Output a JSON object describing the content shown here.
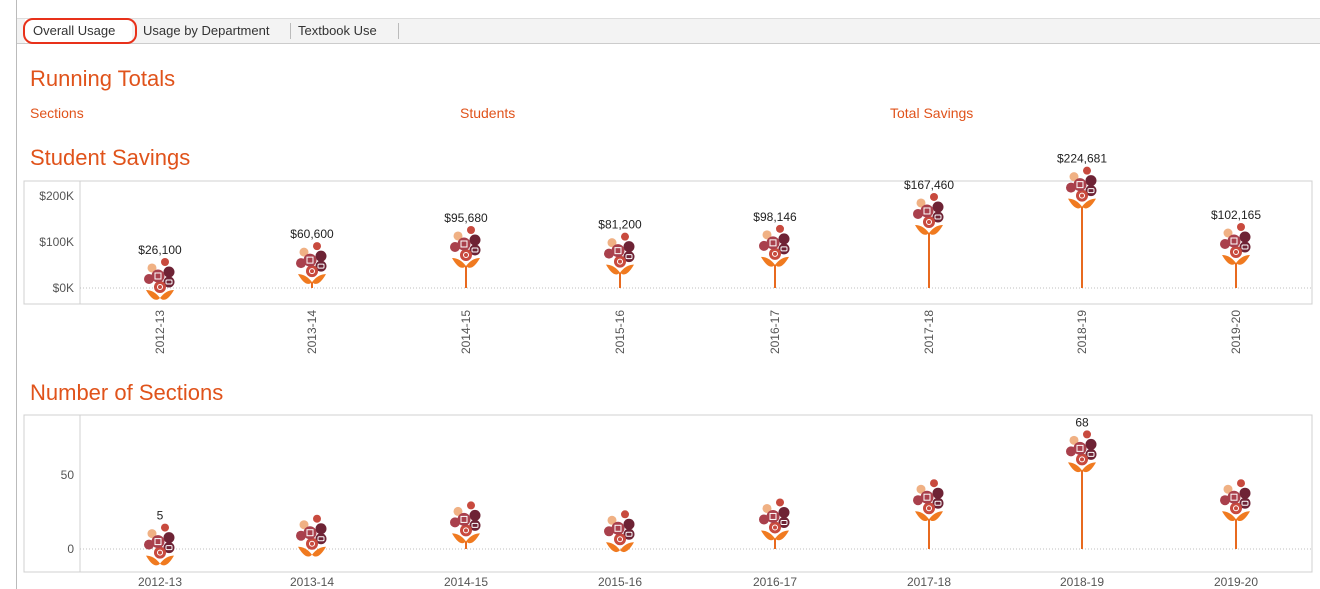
{
  "tabs": [
    {
      "label": "Overall Usage",
      "active": true
    },
    {
      "label": "Usage by Department",
      "active": false
    },
    {
      "label": "Textbook Use",
      "active": false
    }
  ],
  "running_totals": {
    "title": "Running Totals",
    "kpis": [
      {
        "label": "Sections",
        "value": ""
      },
      {
        "label": "Students",
        "value": ""
      },
      {
        "label": "Total Savings",
        "value": ""
      }
    ]
  },
  "colors": {
    "accent": "#e0531b",
    "stem": "#e86a1f",
    "leaf": "#f07a20",
    "highlight": "#e8311a",
    "petal_dark": "#6e2335",
    "petal_mid": "#a9404c",
    "petal_red": "#c84a3e",
    "petal_orange": "#e9824b",
    "petal_light": "#f0b184",
    "center": "#d9a59a"
  },
  "chart_data": [
    {
      "type": "lollipop",
      "title": "Student Savings",
      "categories": [
        "2012-13",
        "2013-14",
        "2014-15",
        "2015-16",
        "2016-17",
        "2017-18",
        "2018-19",
        "2019-20"
      ],
      "values": [
        26100,
        60600,
        95680,
        81200,
        98146,
        167460,
        224681,
        102165
      ],
      "value_labels": [
        "$26,100",
        "$60,600",
        "$95,680",
        "$81,200",
        "$98,146",
        "$167,460",
        "$224,681",
        "$102,165"
      ],
      "yticks": [
        0,
        100000,
        200000
      ],
      "ytick_labels": [
        "$0K",
        "$100K",
        "$200K"
      ],
      "xtick_rotation": "vertical",
      "grid": false
    },
    {
      "type": "lollipop",
      "title": "Number of Sections",
      "categories": [
        "2012-13",
        "2013-14",
        "2014-15",
        "2015-16",
        "2016-17",
        "2017-18",
        "2018-19",
        "2019-20"
      ],
      "values": [
        5,
        11,
        20,
        14,
        22,
        35,
        68,
        35
      ],
      "value_labels": [
        "5",
        "",
        "",
        "",
        "",
        "",
        "68",
        ""
      ],
      "yticks": [
        0,
        50
      ],
      "ytick_labels": [
        "0",
        "50"
      ],
      "xtick_rotation": "horizontal",
      "grid": false
    }
  ]
}
